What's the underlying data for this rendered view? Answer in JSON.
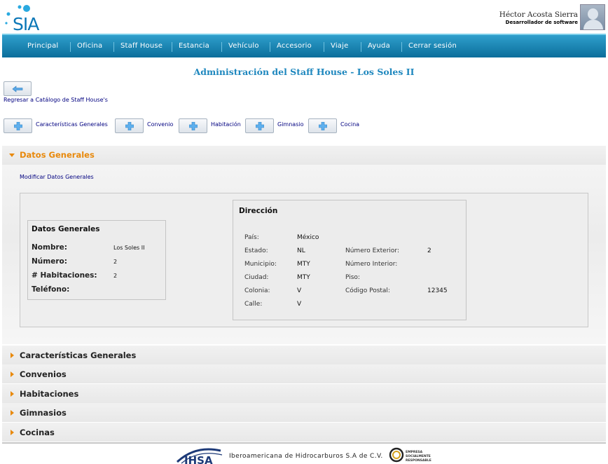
{
  "header": {
    "logo_text": "SIA",
    "user_name": "Héctor Acosta Sierra",
    "user_role": "Desarrollador de software"
  },
  "nav": {
    "items": [
      "Principal",
      "Oficina",
      "Staff House",
      "Estancia",
      "Vehículo",
      "Accesorio",
      "Viaje",
      "Ayuda",
      "Cerrar sesión"
    ]
  },
  "page": {
    "title": "Administración del Staff House - Los Soles II",
    "back_link": "Regresar a Catálogo de Staff House's"
  },
  "add_buttons": [
    {
      "label": "Características Generales"
    },
    {
      "label": "Convenio"
    },
    {
      "label": "Habitación"
    },
    {
      "label": "Gimnasio"
    },
    {
      "label": "Cocina"
    }
  ],
  "datos_generales_section": {
    "title": "Datos Generales",
    "modify_link": "Modificar Datos Generales",
    "box": {
      "title": "Datos Generales",
      "fields": [
        {
          "label": "Nombre:",
          "value": "Los Soles II"
        },
        {
          "label": "Número:",
          "value": "2"
        },
        {
          "label": "# Habitaciones:",
          "value": "2"
        },
        {
          "label": "Teléfono:",
          "value": ""
        }
      ]
    },
    "direccion": {
      "title": "Dirección",
      "left": [
        {
          "label": "País:",
          "value": "México"
        },
        {
          "label": "Estado:",
          "value": "NL"
        },
        {
          "label": "Municipio:",
          "value": "MTY"
        },
        {
          "label": "Ciudad:",
          "value": "MTY"
        },
        {
          "label": "Colonia:",
          "value": "V"
        },
        {
          "label": "Calle:",
          "value": "V"
        }
      ],
      "right": [
        {
          "label": "Número Exterior:",
          "value": "2"
        },
        {
          "label": "Número Interior:",
          "value": ""
        },
        {
          "label": "Piso:",
          "value": ""
        },
        {
          "label": "Código Postal:",
          "value": "12345"
        }
      ]
    }
  },
  "collapsed_sections": [
    "Características Generales",
    "Convenios",
    "Habitaciones",
    "Gimnasios",
    "Cocinas"
  ],
  "footer": {
    "logo_text": "IHSA",
    "company": "Iberoamericana de Hidrocarburos S.A de C.V.",
    "esr_text": "EMPRESA SOCIALMENTE RESPONSABLE"
  },
  "colors": {
    "nav_top": "#2f9fcc",
    "nav_bottom": "#0b6e9b",
    "title": "#1e87be",
    "accent_orange": "#e8890c",
    "link": "#000080"
  }
}
